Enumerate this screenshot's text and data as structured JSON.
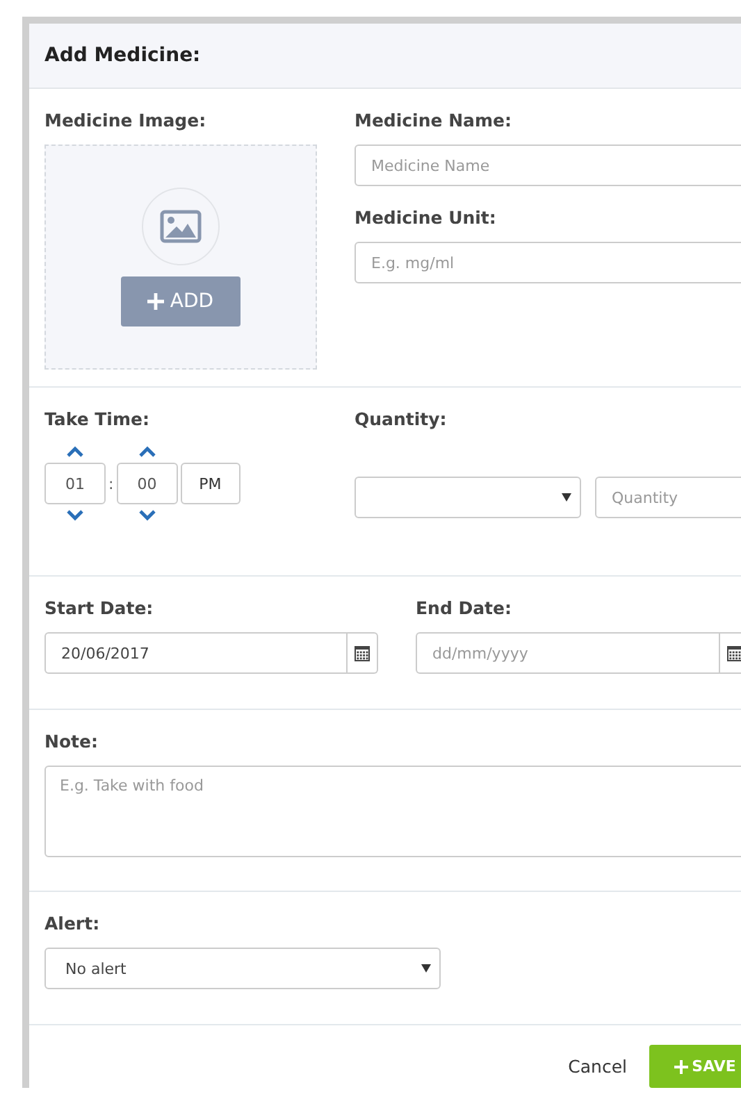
{
  "dialog": {
    "title": "Add Medicine:"
  },
  "image": {
    "label": "Medicine Image:",
    "button": "ADD"
  },
  "name": {
    "label": "Medicine Name:",
    "placeholder": "Medicine Name"
  },
  "unit": {
    "label": "Medicine Unit:",
    "placeholder": "E.g. mg/ml"
  },
  "take_time": {
    "label": "Take Time:",
    "hour": "01",
    "separator": ":",
    "minute": "00",
    "meridian": "PM"
  },
  "quantity": {
    "label": "Quantity:",
    "placeholder": "Quantity"
  },
  "start_date": {
    "label": "Start Date:",
    "value": "20/06/2017"
  },
  "end_date": {
    "label": "End Date:",
    "placeholder": "dd/mm/yyyy"
  },
  "note": {
    "label": "Note:",
    "placeholder": "E.g. Take with food"
  },
  "alert": {
    "label": "Alert:",
    "value": "No alert"
  },
  "footer": {
    "cancel": "Cancel",
    "save": "SAVE"
  }
}
